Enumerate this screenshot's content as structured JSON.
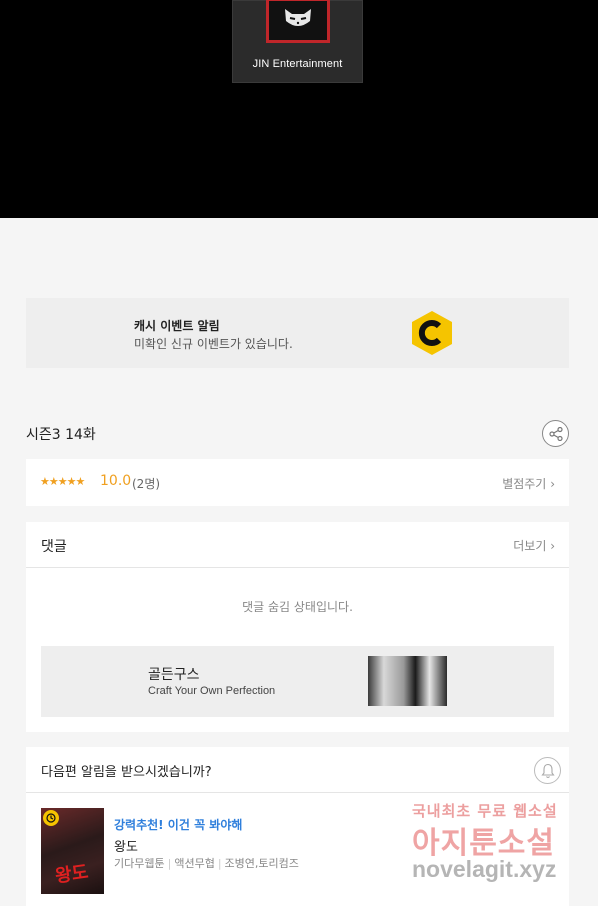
{
  "viewer": {
    "logo_text": "JIN Entertainment"
  },
  "cash_event": {
    "title": "캐시 이벤트 알림",
    "subtitle": "미확인 신규 이벤트가 있습니다.",
    "icon": "cash-c-icon",
    "icon_color": "#f5c400"
  },
  "episode": {
    "title": "시즌3 14화",
    "share_icon": "share-icon"
  },
  "rating": {
    "stars": "★★★★★",
    "score": "10.0",
    "count": "(2명)",
    "rate_label": "별점주기",
    "accent_color": "#f0a020"
  },
  "comments": {
    "title": "댓글",
    "more_label": "더보기",
    "hidden_message": "댓글 숨김 상태입니다."
  },
  "ad": {
    "title": "골든구스",
    "subtitle": "Craft Your Own Perfection"
  },
  "next_episode": {
    "prompt": "다음편 알림을 받으시겠습니까?",
    "bell_icon": "bell-icon",
    "recommendation": {
      "tag": "강력추천! 이건 꼭 봐야해",
      "tag_color": "#2f7fdc",
      "name": "왕도",
      "thumb_logo": "왕도",
      "meta": [
        "기다무웹툰",
        "액션무협",
        "조병연,토리컴즈"
      ]
    }
  },
  "watermark": {
    "line1": "국내최초 무료 웹소설",
    "line2": "아지툰소설",
    "line3": "novelagit.xyz"
  }
}
